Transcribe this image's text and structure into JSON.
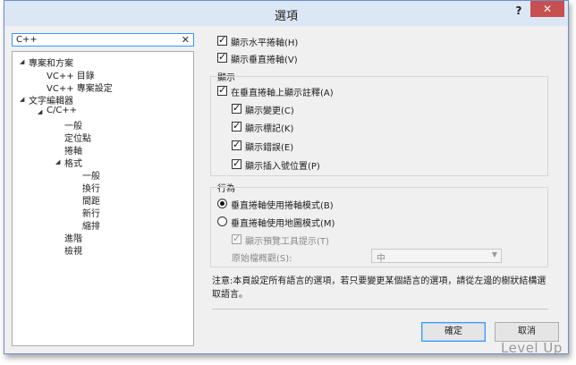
{
  "window": {
    "title": "選項",
    "help": "?",
    "close": "✕"
  },
  "search": {
    "value": "C++",
    "clear": "✕"
  },
  "tree": [
    {
      "label": "專案和方案",
      "arrow": "◢"
    },
    {
      "label": "VC++ 目錄"
    },
    {
      "label": "VC++ 專案設定"
    },
    {
      "label": "文字編輯器",
      "arrow": "◢"
    },
    {
      "label": "C/C++",
      "arrow": "◢"
    },
    {
      "label": "一般"
    },
    {
      "label": "定位點"
    },
    {
      "label": "捲軸"
    },
    {
      "label": "格式",
      "arrow": "◢"
    },
    {
      "label": "一般"
    },
    {
      "label": "換行"
    },
    {
      "label": "間距"
    },
    {
      "label": "新行"
    },
    {
      "label": "縮排"
    },
    {
      "label": "進階"
    },
    {
      "label": "檢視"
    }
  ],
  "options": {
    "show_hscroll": {
      "label": "顯示水平捲軸(H)",
      "checked": true
    },
    "show_vscroll": {
      "label": "顯示垂直捲軸(V)",
      "checked": true
    }
  },
  "display": {
    "group_label": "顯示",
    "annotations": {
      "label": "在垂直捲軸上顯示註釋(A)",
      "checked": true
    },
    "changes": {
      "label": "顯示變更(C)",
      "checked": true
    },
    "marks": {
      "label": "顯示標記(K)",
      "checked": true
    },
    "errors": {
      "label": "顯示錯誤(E)",
      "checked": true
    },
    "caret": {
      "label": "顯示插入號位置(P)",
      "checked": true
    }
  },
  "behavior": {
    "group_label": "行為",
    "bar_mode": {
      "label": "垂直捲軸使用捲軸模式(B)",
      "selected": true
    },
    "map_mode": {
      "label": "垂直捲軸使用地圖模式(M)",
      "selected": false
    },
    "preview_tooltip": {
      "label": "顯示預覽工具提示(T)",
      "checked": true,
      "disabled": true
    },
    "source_overview_label": "原始檔概觀(S):",
    "source_overview_value": "中"
  },
  "note": "注意:本頁設定所有語言的選項，若只要變更某個語言的選項，請從左邊的樹狀結構選取語言。",
  "buttons": {
    "ok": "確定",
    "cancel": "取消"
  },
  "watermark": "Level Up",
  "colors": {
    "titlebar": "#dce7f5",
    "close": "#c75050",
    "focus": "#3399ff"
  }
}
